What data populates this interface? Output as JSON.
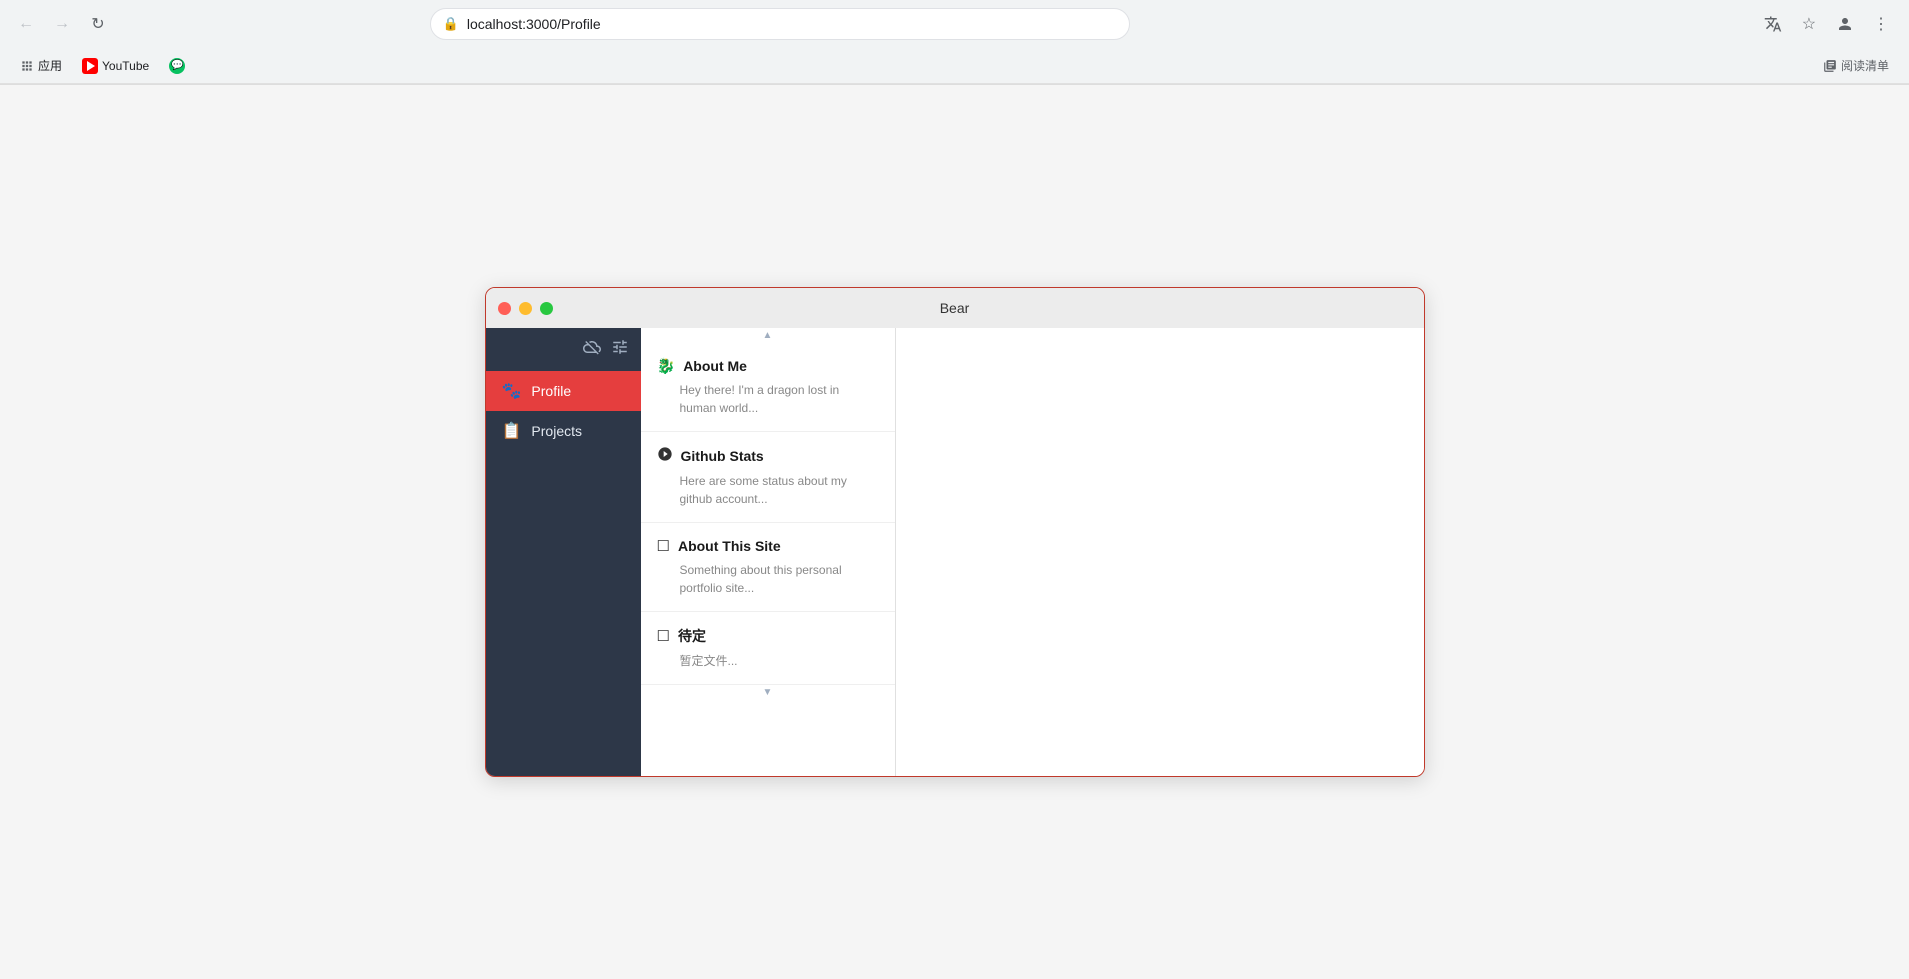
{
  "browser": {
    "url": "localhost:3000/Profile",
    "back_disabled": true,
    "forward_disabled": true,
    "bookmarks": [
      {
        "id": "apps",
        "label": "应用",
        "icon": "grid"
      },
      {
        "id": "youtube",
        "label": "YouTube",
        "icon": "youtube"
      },
      {
        "id": "wechat",
        "label": "",
        "icon": "wechat"
      }
    ],
    "reading_list_label": "阅读清单"
  },
  "window": {
    "title": "Bear"
  },
  "sidebar": {
    "items": [
      {
        "id": "profile",
        "label": "Profile",
        "icon": "paw",
        "active": true
      },
      {
        "id": "projects",
        "label": "Projects",
        "icon": "book",
        "active": false
      }
    ]
  },
  "notes": [
    {
      "id": "about-me",
      "icon": "🐉",
      "title": "About Me",
      "preview": "Hey there! I'm a dragon lost in human world..."
    },
    {
      "id": "github-stats",
      "icon": "🌐",
      "title": "Github Stats",
      "preview": "Here are some status about my github account..."
    },
    {
      "id": "about-site",
      "icon": "☐",
      "title": "About This Site",
      "preview": "Something about this personal portfolio site..."
    },
    {
      "id": "pending",
      "icon": "☐",
      "title": "待定",
      "preview": "暂定文件..."
    }
  ]
}
